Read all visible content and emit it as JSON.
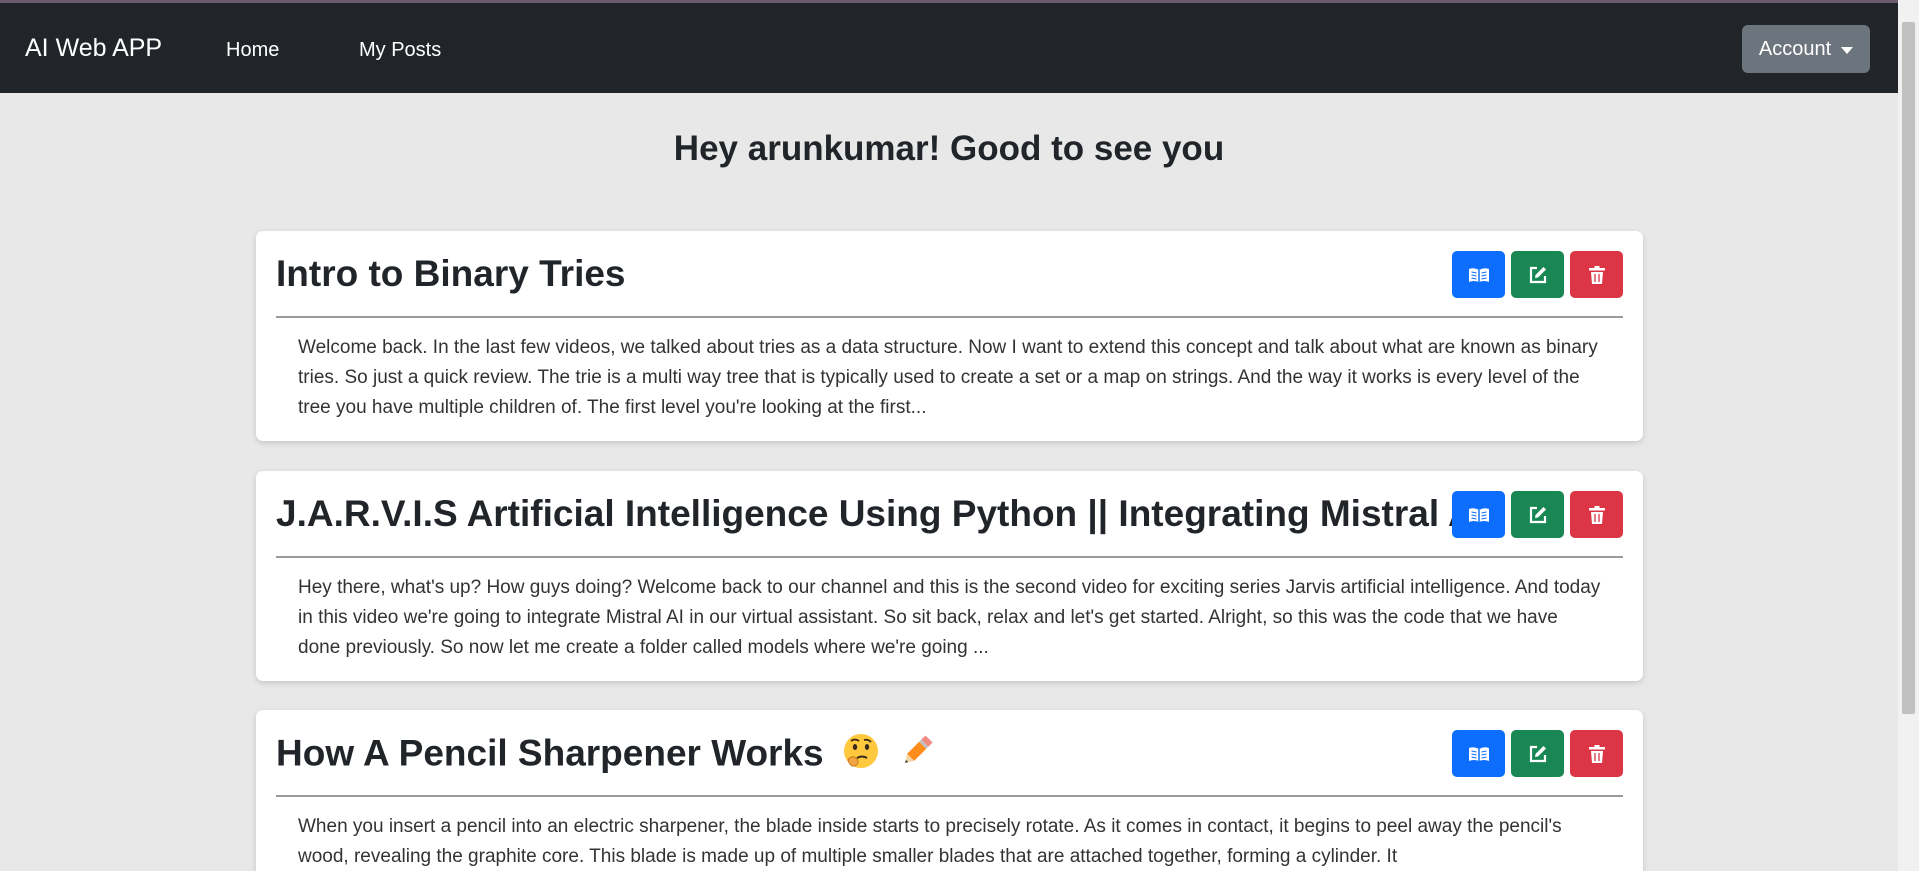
{
  "navbar": {
    "brand": "AI Web APP",
    "links": [
      "Home",
      "My Posts"
    ],
    "account_label": "Account"
  },
  "greeting": "Hey arunkumar! Good to see you",
  "posts": [
    {
      "title": "Intro to Binary Tries",
      "excerpt": "Welcome back. In the last few videos, we talked about tries as a data structure. Now I want to extend this concept and talk about what are known as binary tries. So just a quick review. The trie is a multi way tree that is typically used to create a set or a map on strings. And the way it works is every level of the tree you have multiple children of. The first level you're looking at the first..."
    },
    {
      "title": "J.A.R.V.I.S Artificial Intelligence Using Python || Integrating Mistral AI",
      "excerpt": "Hey there, what's up? How guys doing? Welcome back to our channel and this is the second video for exciting series Jarvis artificial intelligence. And today in this video we're going to integrate Mistral AI in our virtual assistant. So sit back, relax and let's get started. Alright, so this was the code that we have done previously. So now let me create a folder called models where we're going ..."
    },
    {
      "title": "How A Pencil Sharpener Works",
      "excerpt": "When you insert a pencil into an electric sharpener, the blade inside starts to precisely rotate. As it comes in contact, it begins to peel away the pencil's wood, revealing the graphite core. This blade is made up of multiple smaller blades that are attached together, forming a cylinder. It"
    }
  ],
  "icons": {
    "read": "book-open-icon",
    "edit": "pencil-square-icon",
    "delete": "trash-icon",
    "caret": "caret-down-icon",
    "emoji_thinking": "thinking-face-icon",
    "emoji_pencil": "pencil-emoji-icon"
  },
  "colors": {
    "navbar": "#212529",
    "read_button": "#0d6efd",
    "edit_button": "#198754",
    "delete_button": "#dc3545",
    "account_button": "#6c757d",
    "page_background": "#e8e8e8"
  }
}
